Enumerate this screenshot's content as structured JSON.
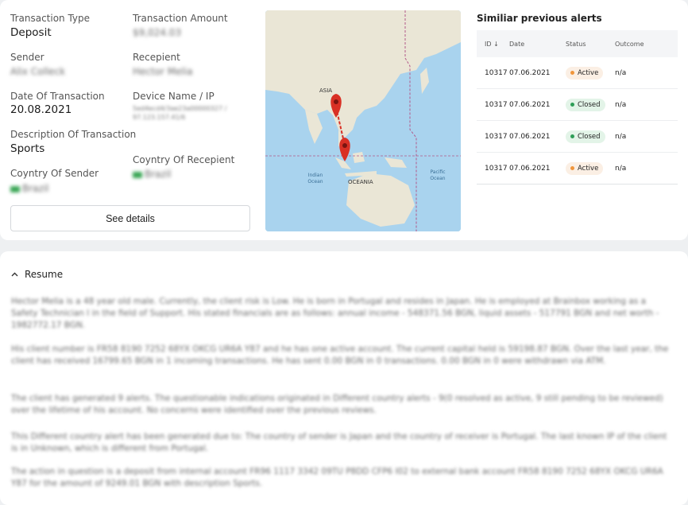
{
  "transaction": {
    "type_label": "Transaction Type",
    "type_value": "Deposit",
    "amount_label": "Transaction Amount",
    "amount_value": "$9,024.03",
    "sender_label": "Sender",
    "sender_value": "Alix Colleck",
    "recipient_label": "Recepient",
    "recipient_value": "Hector Melia",
    "date_label": "Date Of Transaction",
    "date_value": "20.08.2021",
    "device_label": "Device Name / IP",
    "device_value": "5ed4ecd4/3ae23a00000327 / 97.123.157.41/6",
    "description_label": "Description Of Transaction",
    "description_value": "Sports",
    "country_sender_label": "Coyntry Of Sender",
    "country_sender_value": "Brazil",
    "country_recipient_label": "Coyntry Of Recepient",
    "country_recipient_value": "Brazil",
    "see_details_label": "See details"
  },
  "map": {
    "labels": {
      "asia": "ASIA",
      "indian_ocean": "Indian Ocean",
      "oceania": "OCEANIA",
      "pacific_ocean": "Pacific Ocean"
    }
  },
  "alerts": {
    "title": "Similiar previous alerts",
    "columns": {
      "id": "ID ↓",
      "date": "Date",
      "status": "Status",
      "outcome": "Outcome"
    },
    "rows": [
      {
        "id": "10317",
        "date": "07.06.2021",
        "status": "Active",
        "outcome": "n/a"
      },
      {
        "id": "10317",
        "date": "07.06.2021",
        "status": "Closed",
        "outcome": "n/a"
      },
      {
        "id": "10317",
        "date": "07.06.2021",
        "status": "Closed",
        "outcome": "n/a"
      },
      {
        "id": "10317",
        "date": "07.06.2021",
        "status": "Active",
        "outcome": "n/a"
      }
    ]
  },
  "resume": {
    "title": "Resume",
    "paragraphs": [
      "Hector Melia is a 48 year old male. Currently, the client risk is Low. He is born in Portugal and resides in Japan. He is employed at Brainbox working as a Safety Technician I in the field of Support. His stated financials are as follows: annual income - 548371.56 BGN, liquid assets - 517791 BGN and net worth - 1982772.17 BGN.",
      "His client number is FR58 8190 7252 68YX OKCG UR6A Y87 and he has one active account. The current capital held is 59198.87 BGN. Over the last year, the client has received 16799.65 BGN in 1 incoming transactions. He has sent 0.00 BGN in 0 transactions. 0.00 BGN in 0 were withdrawn via ATM.",
      "The client has generated 9 alerts. The questionable indications originated in Different country alerts - 9(0 resolved as active, 9 still pending to be reviewed) over the lifetime of his account. No concerns were identified over the previous reviews.",
      "This Different country alert has been generated due to: The country of sender is Japan and the country of receiver is Portugal. The last known IP of the client is in Unknown, which is different from Portugal.",
      "The action in question is a deposit from internal account FR96 1117 3342 09TU P8DD CFP6 I02 to external bank account FR58 8190 7252 68YX OKCG UR6A Y87 for the amount of 9249.01 BGN with description Sports."
    ]
  },
  "colors": {
    "active_dot": "#f0963c",
    "closed_dot": "#2f9e57",
    "map_water": "#a9d3ee",
    "map_land": "#eae6d6",
    "pin": "#d93025"
  }
}
